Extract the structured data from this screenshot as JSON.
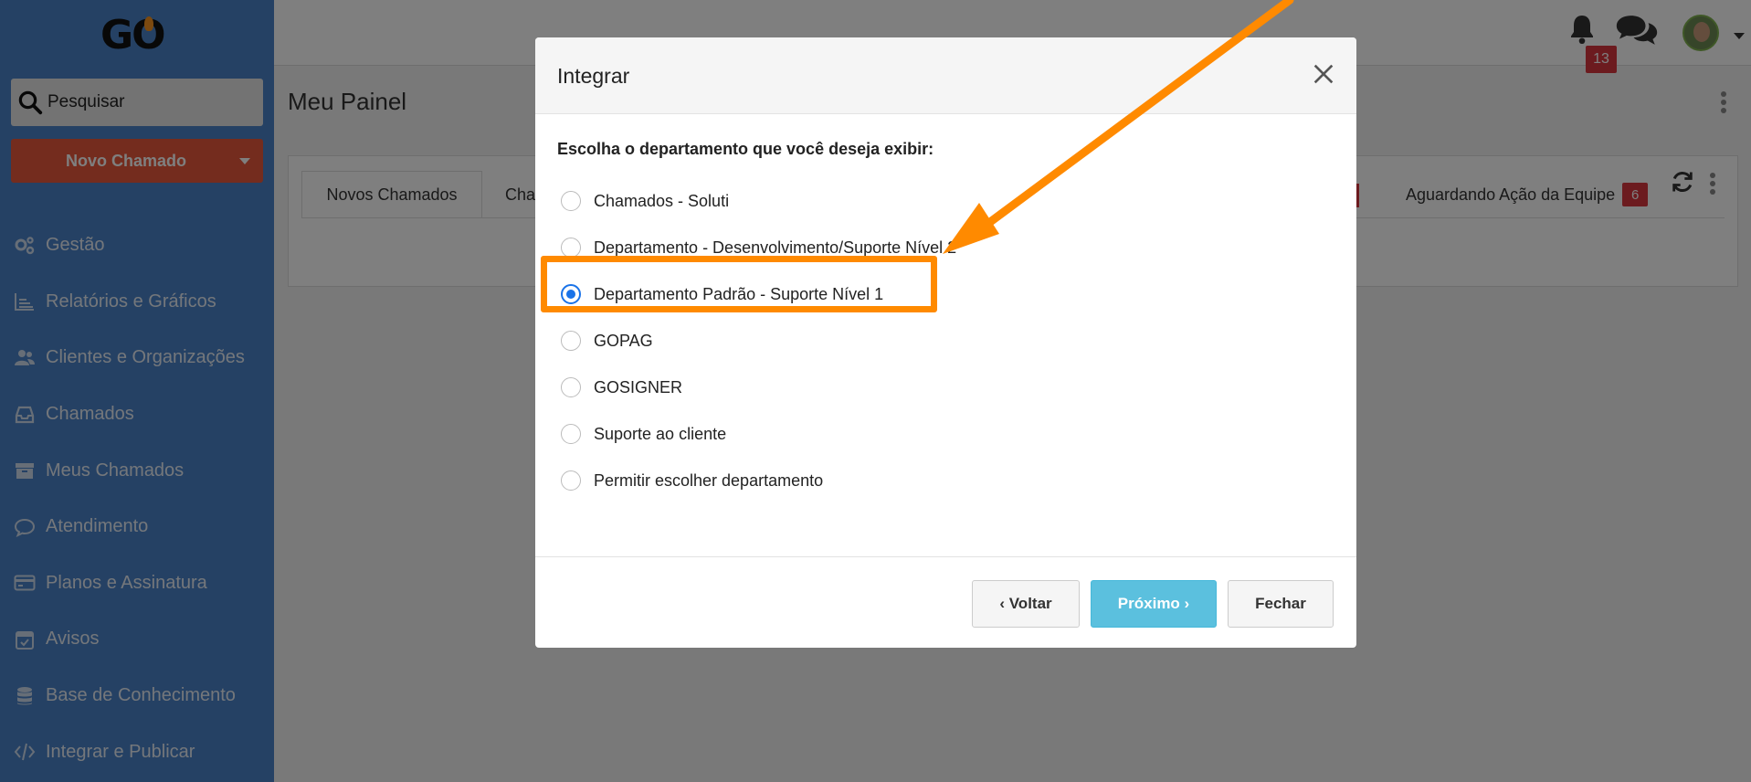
{
  "app": {
    "logo_text": "GO"
  },
  "sidebar": {
    "search_label": "Pesquisar",
    "new_ticket_label": "Novo Chamado",
    "items": [
      {
        "label": "Gestão",
        "icon": "gears-icon"
      },
      {
        "label": "Relatórios e Gráficos",
        "icon": "chart-icon"
      },
      {
        "label": "Clientes e Organizações",
        "icon": "users-icon"
      },
      {
        "label": "Chamados",
        "icon": "inbox-icon"
      },
      {
        "label": "Meus Chamados",
        "icon": "archive-icon"
      },
      {
        "label": "Atendimento",
        "icon": "chat-bubble-icon"
      },
      {
        "label": "Planos e Assinatura",
        "icon": "credit-card-icon"
      },
      {
        "label": "Avisos",
        "icon": "calendar-check-icon"
      },
      {
        "label": "Base de Conhecimento",
        "icon": "database-icon"
      },
      {
        "label": "Integrar e Publicar",
        "icon": "code-icon"
      }
    ]
  },
  "topbar": {
    "notification_count": "13"
  },
  "main": {
    "page_title": "Meu Painel",
    "tabs": [
      {
        "label": "Novos Chamados"
      },
      {
        "label": "Cha"
      },
      {
        "label": "Aguardando Ação da Equipe",
        "badge": "6"
      }
    ]
  },
  "modal": {
    "title": "Integrar",
    "question": "Escolha o departamento que você deseja exibir:",
    "options": [
      {
        "label": "Chamados - Soluti",
        "checked": false
      },
      {
        "label": "Departamento - Desenvolvimento/Suporte Nível 2",
        "checked": false
      },
      {
        "label": "Departamento Padrão - Suporte Nível 1",
        "checked": true
      },
      {
        "label": "GOPAG",
        "checked": false
      },
      {
        "label": "GOSIGNER",
        "checked": false
      },
      {
        "label": "Suporte ao cliente",
        "checked": false
      },
      {
        "label": "Permitir escolher departamento",
        "checked": false
      }
    ],
    "buttons": {
      "back": "‹ Voltar",
      "next": "Próximo ›",
      "close": "Fechar"
    }
  },
  "colors": {
    "sidebar_bg": "#4a83c9",
    "new_ticket_bg": "#e8593c",
    "badge_red": "#d9363e",
    "primary_button": "#5bc0de",
    "highlight_orange": "#ff8a00",
    "radio_checked": "#1a73e8"
  }
}
